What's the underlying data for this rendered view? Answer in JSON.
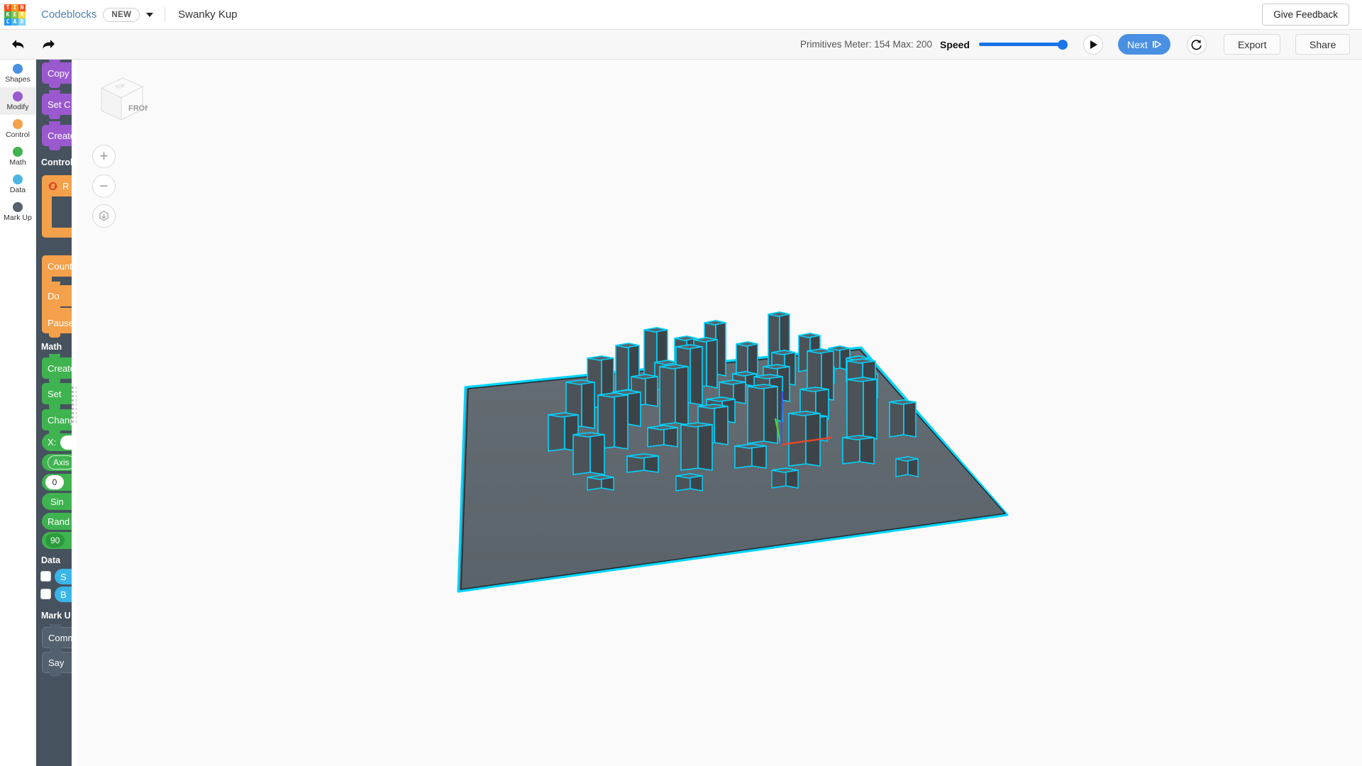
{
  "header": {
    "logo_letters": [
      "T",
      "I",
      "N",
      "K",
      "E",
      "R",
      "C",
      "A",
      "D"
    ],
    "app_name": "Codeblocks",
    "new_badge": "NEW",
    "project_title": "Swanky Kup",
    "feedback_label": "Give Feedback",
    "caret_icon": "chevron-down-icon"
  },
  "toolbar": {
    "undo_icon": "undo-arrow-icon",
    "redo_icon": "redo-arrow-icon",
    "primitives_meter": "Primitives Meter: 154 Max: 200",
    "primitives_current": 154,
    "primitives_max": 200,
    "speed_label": "Speed",
    "speed_value": 100,
    "play_icon": "play-triangle-icon",
    "next_label": "Next",
    "next_icon": "step-forward-icon",
    "reset_icon": "restart-arrow-icon",
    "export_label": "Export",
    "share_label": "Share"
  },
  "rail": {
    "items": [
      {
        "label": "Shapes",
        "color": "#4a90e2",
        "active": false
      },
      {
        "label": "Modify",
        "color": "#9b59d0",
        "active": true
      },
      {
        "label": "Control",
        "color": "#f5a04a",
        "active": false
      },
      {
        "label": "Math",
        "color": "#3eb34f",
        "active": false
      },
      {
        "label": "Data",
        "color": "#4db6e0",
        "active": false
      },
      {
        "label": "Mark Up",
        "color": "#55626e",
        "active": false
      }
    ]
  },
  "blocks_panel": {
    "modify": [
      {
        "label": "Copy",
        "color": "purple"
      },
      {
        "label": "Set C",
        "color": "purple"
      },
      {
        "label": "Create",
        "color": "purple"
      }
    ],
    "control_header": "Control",
    "control": [
      {
        "label": "R",
        "color": "orange",
        "icon": "repeat-loop-icon"
      },
      {
        "label": "Count",
        "color": "orange"
      },
      {
        "label": "Do",
        "color": "orange"
      },
      {
        "label": "Pause",
        "color": "orange"
      }
    ],
    "math_header": "Math",
    "math": [
      {
        "label": "Create",
        "color": "green"
      },
      {
        "label": "Set",
        "color": "green"
      },
      {
        "label": "Chang",
        "color": "green"
      },
      {
        "label": "X:",
        "color": "green",
        "pill": ""
      },
      {
        "label": "Axis",
        "color": "green"
      },
      {
        "label": "0",
        "color": "green",
        "pill_only": true
      },
      {
        "label": "Sin",
        "color": "green"
      },
      {
        "label": "Rand",
        "color": "green"
      },
      {
        "label": "90",
        "color": "green",
        "pill_only": true
      }
    ],
    "data_header": "Data",
    "data": [
      {
        "label": "S",
        "color": "blue",
        "checkbox": true
      },
      {
        "label": "B",
        "color": "blue",
        "checkbox": true
      }
    ],
    "markup_header": "Mark U",
    "markup": [
      {
        "label": "Comm",
        "color": "gray"
      },
      {
        "label": "Say",
        "color": "gray"
      }
    ],
    "grip_icon": "drag-handle-icon"
  },
  "viewport": {
    "viewcube_front": "FRONT",
    "viewcube_top": "TOP",
    "zoom_in_icon": "plus-icon",
    "zoom_out_icon": "minus-icon",
    "fit_view_icon": "fit-to-view-cube-icon",
    "ground_fill": "#5d666c",
    "selection_color": "#00d4ff",
    "building_fill": "#4b5358",
    "background": "#fafafa",
    "axis_x_color": "#e8482a",
    "axis_y_color": "#4ad32a",
    "axis_z_color": "#3355ee"
  }
}
